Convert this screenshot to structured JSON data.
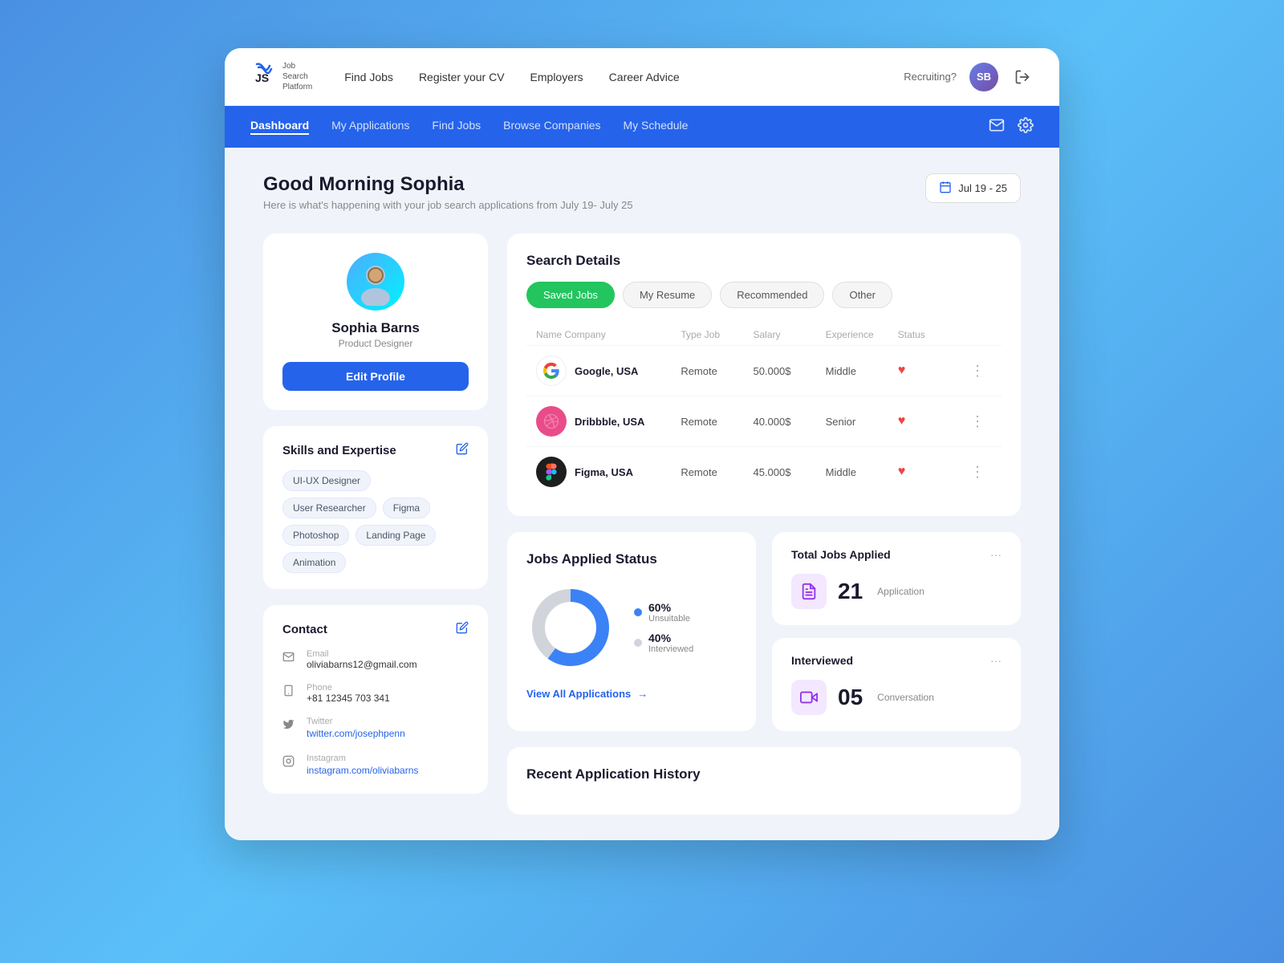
{
  "topnav": {
    "brand": "JS",
    "brand_sub1": "Job",
    "brand_sub2": "Search",
    "brand_sub3": "Platform",
    "links": [
      "Find Jobs",
      "Register your CV",
      "Employers",
      "Career Advice"
    ],
    "recruiting_label": "Recruiting?",
    "avatar_initials": "SB"
  },
  "bluenav": {
    "links": [
      "Dashboard",
      "My Applications",
      "Find Jobs",
      "Browse Companies",
      "My Schedule"
    ],
    "active": "Dashboard"
  },
  "greeting": {
    "title": "Good Morning Sophia",
    "subtitle": "Here is what's happening with your job search applications from July 19- July 25",
    "date_range": "Jul 19 - 25"
  },
  "profile": {
    "name": "Sophia Barns",
    "title": "Product Designer",
    "edit_btn": "Edit Profile",
    "skills_title": "Skills and Expertise",
    "skills": [
      "UI-UX Designer",
      "User Researcher",
      "Figma",
      "Photoshop",
      "Landing Page",
      "Animation"
    ],
    "contact_title": "Contact",
    "email_label": "Email",
    "email_value": "oliviabarns12@gmail.com",
    "phone_label": "Phone",
    "phone_value": "+81 12345 703 341",
    "twitter_label": "Twitter",
    "twitter_value": "twitter.com/josephpenn",
    "instagram_label": "Instagram",
    "instagram_value": "instagram.com/oliviabarns"
  },
  "search_details": {
    "title": "Search Details",
    "tabs": [
      "Saved Jobs",
      "My Resume",
      "Recommended",
      "Other"
    ],
    "active_tab": "Saved Jobs",
    "table_headers": [
      "Name Company",
      "Type Job",
      "Salary",
      "Experience",
      "Status",
      ""
    ],
    "jobs": [
      {
        "company": "Google, USA",
        "type": "Remote",
        "salary": "50.000$",
        "exp": "Middle",
        "logo_type": "google"
      },
      {
        "company": "Dribbble, USA",
        "type": "Remote",
        "salary": "40.000$",
        "exp": "Senior",
        "logo_type": "dribbble"
      },
      {
        "company": "Figma, USA",
        "type": "Remote",
        "salary": "45.000$",
        "exp": "Middle",
        "logo_type": "figma"
      }
    ]
  },
  "jobs_status": {
    "title": "Jobs Applied Status",
    "segments": [
      {
        "label": "Unsuitable",
        "pct": 60,
        "color": "#3b82f6"
      },
      {
        "label": "Interviewed",
        "pct": 40,
        "color": "#d1d5db"
      }
    ],
    "view_btn": "View All Applications"
  },
  "stats": {
    "total_jobs": {
      "title": "Total Jobs Applied",
      "number": "21",
      "sublabel": "Application"
    },
    "interviewed": {
      "title": "Interviewed",
      "number": "05",
      "sublabel": "Conversation"
    }
  },
  "recent": {
    "title": "Recent Application History"
  }
}
